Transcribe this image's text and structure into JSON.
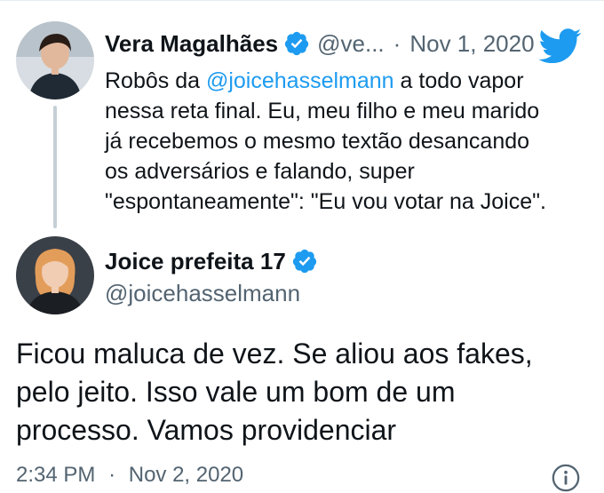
{
  "quoted_tweet": {
    "display_name": "Vera Magalhães",
    "handle": "@ve...",
    "separator": "·",
    "date": "Nov 1, 2020",
    "text_lines": [
      {
        "before": "Robôs da ",
        "mention": "@joicehasselmann",
        "after": " a todo vapor"
      },
      {
        "text": "nessa reta final. Eu, meu filho e meu marido"
      },
      {
        "text": "já recebemos o mesmo textão desancando"
      },
      {
        "text": "os adversários e falando, super"
      },
      {
        "text": "\"espontaneamente\": \"Eu vou votar na Joice\"."
      }
    ]
  },
  "main_tweet": {
    "display_name": "Joice prefeita 17",
    "handle": "@joicehasselmann",
    "text_lines": [
      "Ficou maluca de vez. Se aliou aos fakes,",
      "pelo jeito. Isso vale um bom de um",
      "processo. Vamos providenciar"
    ],
    "time": "2:34 PM",
    "separator": "·",
    "date": "Nov 2, 2020"
  },
  "icons": {
    "verified": "verified-badge-icon",
    "logo": "twitter-bird-icon",
    "info": "info-icon"
  },
  "colors": {
    "accent": "#1d9bf0",
    "text": "#0f1419",
    "muted": "#536471"
  }
}
